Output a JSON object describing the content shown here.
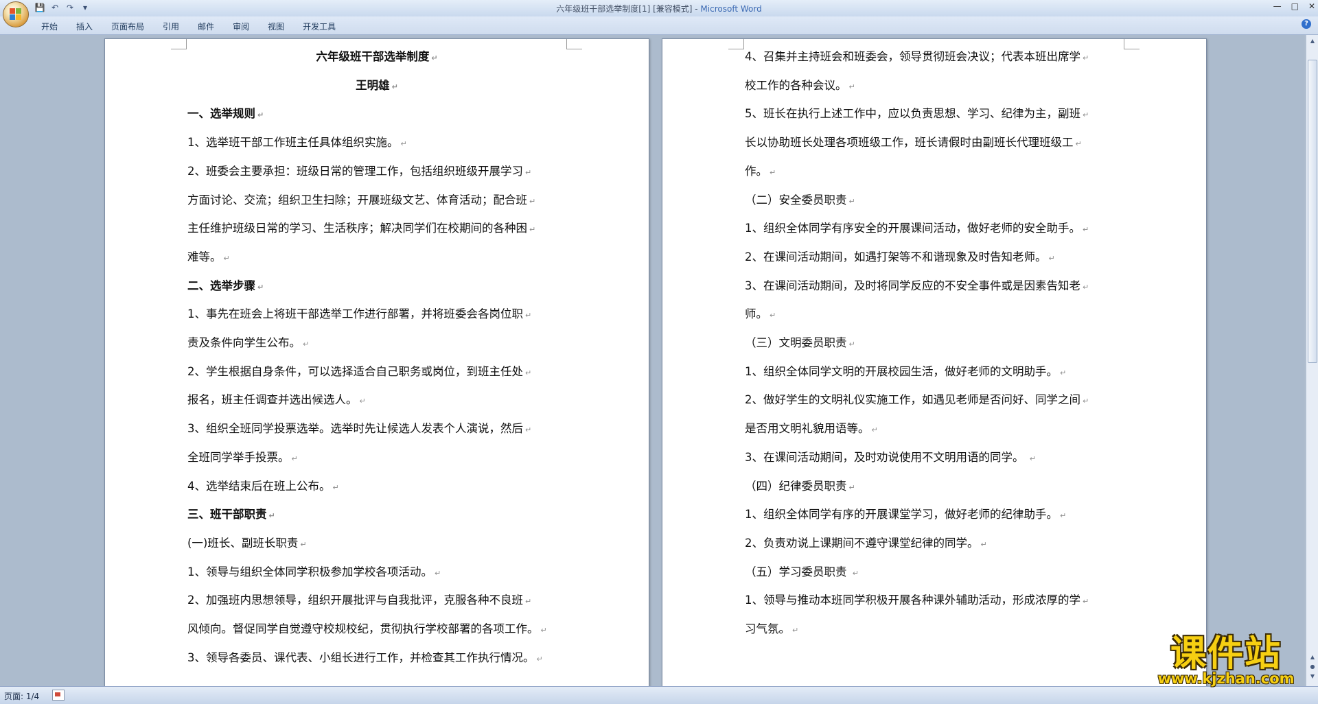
{
  "window": {
    "title": "六年级班干部选举制度[1] [兼容模式] - ",
    "app_name": "Microsoft Word"
  },
  "quick_access": {
    "icons": [
      "save-icon",
      "undo-icon",
      "redo-icon",
      "customize-dropdown-icon"
    ]
  },
  "ribbon": {
    "tabs": [
      "开始",
      "插入",
      "页面布局",
      "引用",
      "邮件",
      "审阅",
      "视图",
      "开发工具"
    ]
  },
  "document": {
    "paragraph_mark": "↵",
    "left_page": [
      {
        "text": "六年级班干部选举制度",
        "style": "title"
      },
      {
        "text": "王明雄",
        "style": "title"
      },
      {
        "text": "一、选举规则",
        "style": "heading"
      },
      {
        "text": "1、选举班干部工作班主任具体组织实施。",
        "style": "body"
      },
      {
        "text": "2、班委会主要承担：班级日常的管理工作，包括组织班级开展学习",
        "style": "body"
      },
      {
        "text": "方面讨论、交流；组织卫生扫除；开展班级文艺、体育活动；配合班",
        "style": "body"
      },
      {
        "text": "主任维护班级日常的学习、生活秩序；解决同学们在校期间的各种困",
        "style": "body"
      },
      {
        "text": "难等。",
        "style": "body"
      },
      {
        "text": "二、选举步骤",
        "style": "heading"
      },
      {
        "text": "1、事先在班会上将班干部选举工作进行部署，并将班委会各岗位职",
        "style": "body"
      },
      {
        "text": "责及条件向学生公布。",
        "style": "body"
      },
      {
        "text": "2、学生根据自身条件，可以选择适合自己职务或岗位，到班主任处",
        "style": "body"
      },
      {
        "text": "报名，班主任调查并选出候选人。",
        "style": "body"
      },
      {
        "text": "3、组织全班同学投票选举。选举时先让候选人发表个人演说，然后",
        "style": "body"
      },
      {
        "text": "全班同学举手投票。",
        "style": "body"
      },
      {
        "text": "4、选举结束后在班上公布。",
        "style": "body"
      },
      {
        "text": "三、班干部职责",
        "style": "heading"
      },
      {
        "text": "(一)班长、副班长职责",
        "style": "body"
      },
      {
        "text": "1、领导与组织全体同学积极参加学校各项活动。",
        "style": "body"
      },
      {
        "text": "2、加强班内思想领导，组织开展批评与自我批评，克服各种不良班",
        "style": "body"
      },
      {
        "text": "风倾向。督促同学自觉遵守校规校纪，贯彻执行学校部署的各项工作。",
        "style": "body"
      },
      {
        "text": "3、领导各委员、课代表、小组长进行工作，并检查其工作执行情况。",
        "style": "body"
      }
    ],
    "right_page": [
      {
        "text": "4、召集并主持班会和班委会，领导贯彻班会决议；代表本班出席学",
        "style": "body"
      },
      {
        "text": "校工作的各种会议。",
        "style": "body"
      },
      {
        "text": "5、班长在执行上述工作中，应以负责思想、学习、纪律为主，副班",
        "style": "body"
      },
      {
        "text": "长以协助班长处理各项班级工作，班长请假时由副班长代理班级工",
        "style": "body"
      },
      {
        "text": "作。",
        "style": "body"
      },
      {
        "text": "（二）安全委员职责",
        "style": "body"
      },
      {
        "text": "1、组织全体同学有序安全的开展课间活动，做好老师的安全助手。",
        "style": "body"
      },
      {
        "text": "2、在课间活动期间，如遇打架等不和谐现象及时告知老师。",
        "style": "body"
      },
      {
        "text": "3、在课间活动期间，及时将同学反应的不安全事件或是因素告知老",
        "style": "body"
      },
      {
        "text": "师。",
        "style": "body"
      },
      {
        "text": " （三）文明委员职责",
        "style": "body"
      },
      {
        "text": "1、组织全体同学文明的开展校园生活，做好老师的文明助手。",
        "style": "body"
      },
      {
        "text": "2、做好学生的文明礼仪实施工作，如遇见老师是否问好、同学之间",
        "style": "body"
      },
      {
        "text": "是否用文明礼貌用语等。",
        "style": "body"
      },
      {
        "text": "3、在课间活动期间，及时劝说使用不文明用语的同学。 ",
        "style": "body"
      },
      {
        "text": "（四）纪律委员职责",
        "style": "body"
      },
      {
        "text": "1、组织全体同学有序的开展课堂学习，做好老师的纪律助手。",
        "style": "body"
      },
      {
        "text": "2、负责劝说上课期间不遵守课堂纪律的同学。",
        "style": "body"
      },
      {
        "text": "（五）学习委员职责 ",
        "style": "body"
      },
      {
        "text": "1、领导与推动本班同学积极开展各种课外辅助活动，形成浓厚的学",
        "style": "body"
      },
      {
        "text": "习气氛。",
        "style": "body"
      }
    ]
  },
  "statusbar": {
    "page_info": "页面: 1/4"
  },
  "watermark": {
    "brand": "课件站",
    "url": "www.kjzhan.com"
  }
}
